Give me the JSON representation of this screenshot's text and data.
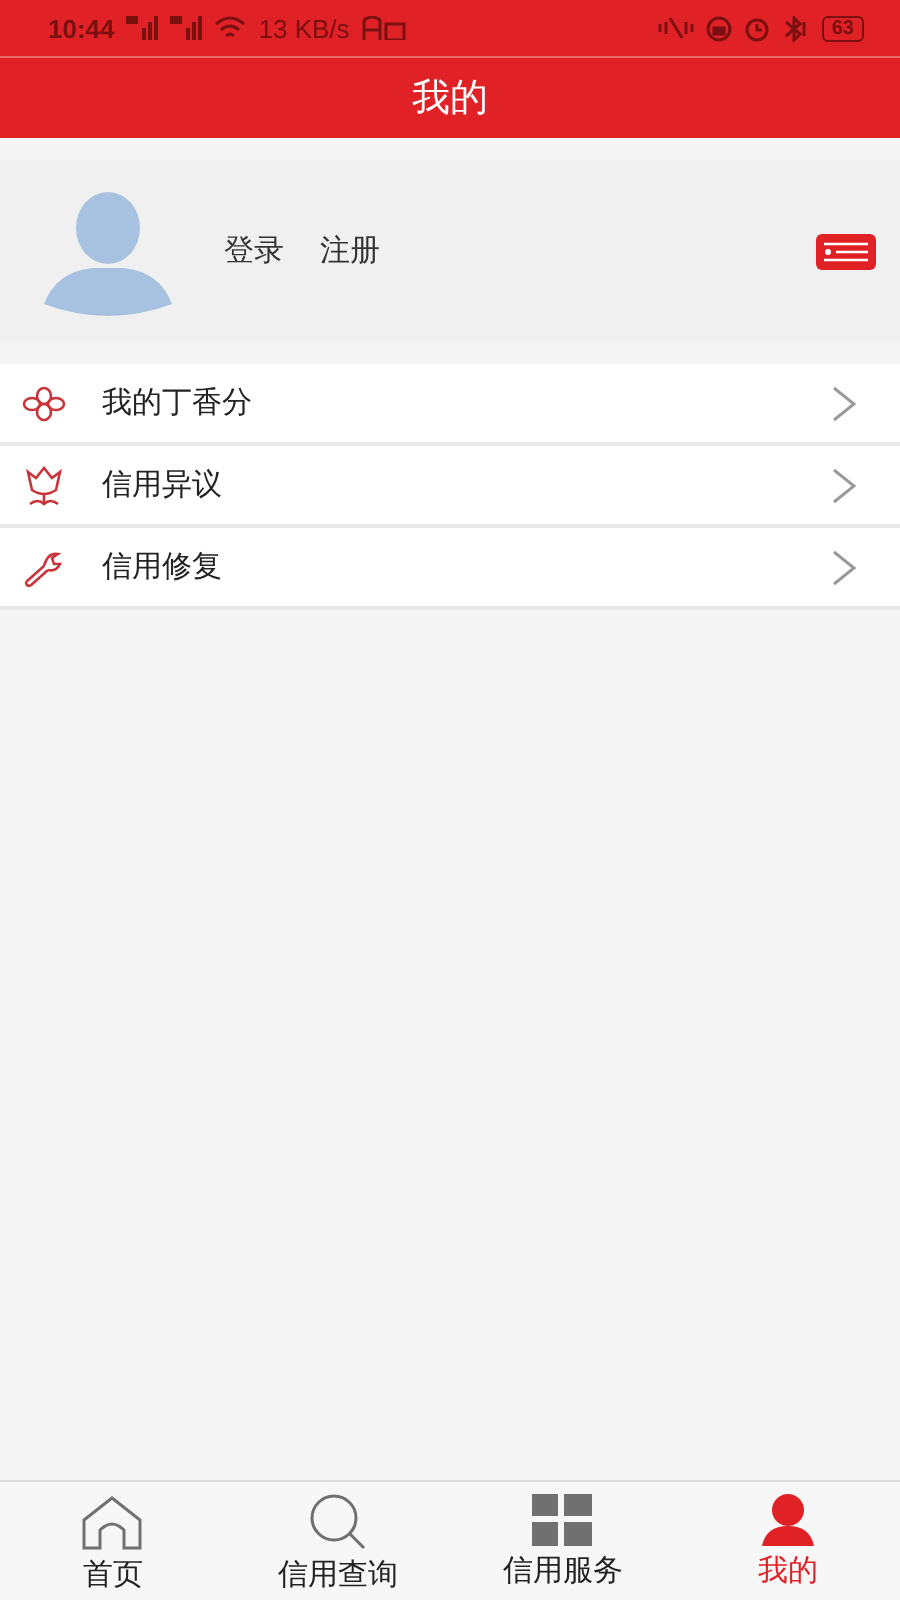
{
  "status_bar": {
    "time": "10:44",
    "speed": "13 KB/s",
    "battery": "63"
  },
  "header": {
    "title": "我的"
  },
  "profile": {
    "login": "登录",
    "register": "注册"
  },
  "menu": [
    {
      "kind": "flower",
      "label": "我的丁香分"
    },
    {
      "kind": "tulip",
      "label": "信用异议"
    },
    {
      "kind": "wrench",
      "label": "信用修复"
    }
  ],
  "tab_bar": [
    {
      "kind": "home",
      "label": "首页",
      "selected": false
    },
    {
      "kind": "search",
      "label": "信用查询",
      "selected": false
    },
    {
      "kind": "grid",
      "label": "信用服务",
      "selected": false
    },
    {
      "kind": "person",
      "label": "我的",
      "selected": true
    }
  ]
}
